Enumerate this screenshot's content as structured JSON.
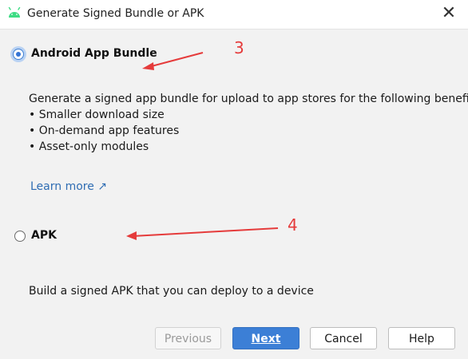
{
  "window": {
    "title": "Generate Signed Bundle or APK",
    "icon": "android-icon",
    "close_glyph": "✕"
  },
  "options": {
    "bundle": {
      "label": "Android App Bundle",
      "selected": true,
      "description": "Generate a signed app bundle for upload to app stores for the following benefits:",
      "benefits": [
        "Smaller download size",
        "On-demand app features",
        "Asset-only modules"
      ],
      "learn_more": "Learn more ↗"
    },
    "apk": {
      "label": "APK",
      "selected": false,
      "description": "Build a signed APK that you can deploy to a device"
    }
  },
  "buttons": {
    "previous": "Previous",
    "next": "Next",
    "cancel": "Cancel",
    "help": "Help"
  },
  "annotations": {
    "step3": "3",
    "step4": "4",
    "color": "#e53b3b"
  },
  "colors": {
    "accent": "#3c7fd6",
    "link": "#2f6db3",
    "android_green": "#3ddc84"
  }
}
